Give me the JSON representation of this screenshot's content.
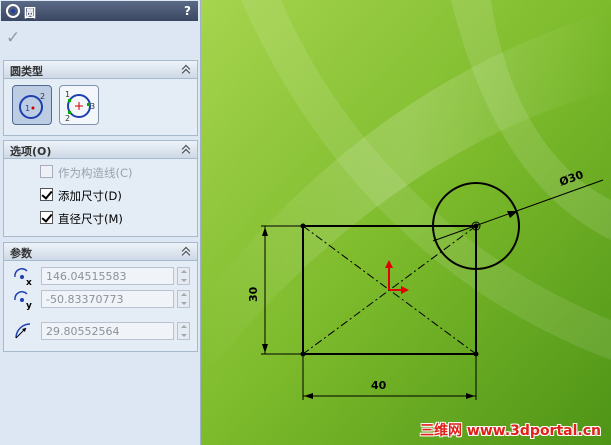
{
  "panel": {
    "title": "圆",
    "help": "?",
    "ok_symbol": "✓"
  },
  "circle_type": {
    "header": "圆类型",
    "buttons": [
      {
        "name": "center-circle",
        "active": true
      },
      {
        "name": "perimeter-circle",
        "active": false
      }
    ]
  },
  "options": {
    "header": "选项(O)",
    "items": [
      {
        "label": "作为构造线(C)",
        "checked": false,
        "enabled": false
      },
      {
        "label": "添加尺寸(D)",
        "checked": true,
        "enabled": true
      },
      {
        "label": "直径尺寸(M)",
        "checked": true,
        "enabled": true
      }
    ]
  },
  "parameters": {
    "header": "参数",
    "center_x": "146.04515583",
    "center_y": "-50.83370773",
    "radius": "29.80552564"
  },
  "sketch": {
    "dim_diameter": "Ø30",
    "dim_height": "30",
    "dim_width": "40"
  },
  "watermark": "三维网 www.3dportal.cn",
  "colors": {
    "title_bar": "#3f4b66",
    "panel_bg": "#dde7f3",
    "canvas_green": "#7dbb2c",
    "origin_red": "#e00000",
    "watermark_red": "#e0201a"
  }
}
